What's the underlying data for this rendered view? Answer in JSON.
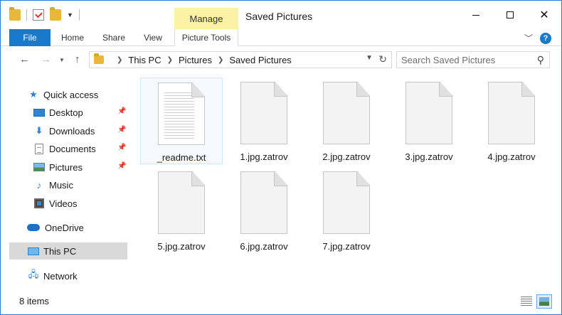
{
  "titlebar": {
    "manage_tab": "Manage",
    "title": "Saved Pictures",
    "icons": [
      "folder-icon",
      "properties-icon",
      "new-folder-icon",
      "customize-qat-icon"
    ]
  },
  "ribbon": {
    "tabs": [
      "File",
      "Home",
      "Share",
      "View",
      "Picture Tools"
    ],
    "help_label": "?"
  },
  "address": {
    "crumbs": [
      "This PC",
      "Pictures",
      "Saved Pictures"
    ]
  },
  "search": {
    "placeholder": "Search Saved Pictures"
  },
  "sidebar": {
    "items": [
      {
        "label": "Quick access",
        "icon": "star-icon"
      },
      {
        "label": "Desktop",
        "icon": "desktop-icon",
        "pinned": true
      },
      {
        "label": "Downloads",
        "icon": "download-icon",
        "pinned": true
      },
      {
        "label": "Documents",
        "icon": "documents-icon",
        "pinned": true
      },
      {
        "label": "Pictures",
        "icon": "pictures-icon",
        "pinned": true
      },
      {
        "label": "Music",
        "icon": "music-icon"
      },
      {
        "label": "Videos",
        "icon": "videos-icon"
      },
      {
        "label": "OneDrive",
        "icon": "cloud-icon"
      },
      {
        "label": "This PC",
        "icon": "computer-icon",
        "selected": true
      },
      {
        "label": "Network",
        "icon": "network-icon"
      }
    ]
  },
  "files": [
    {
      "name": "_readme.txt",
      "type": "txt"
    },
    {
      "name": "1.jpg.zatrov",
      "type": "blank"
    },
    {
      "name": "2.jpg.zatrov",
      "type": "blank"
    },
    {
      "name": "3.jpg.zatrov",
      "type": "blank"
    },
    {
      "name": "4.jpg.zatrov",
      "type": "blank"
    },
    {
      "name": "5.jpg.zatrov",
      "type": "blank"
    },
    {
      "name": "6.jpg.zatrov",
      "type": "blank"
    },
    {
      "name": "7.jpg.zatrov",
      "type": "blank"
    }
  ],
  "status": {
    "count": "8 items"
  },
  "colors": {
    "accent": "#1979ca",
    "manage": "#fbf2a6"
  }
}
